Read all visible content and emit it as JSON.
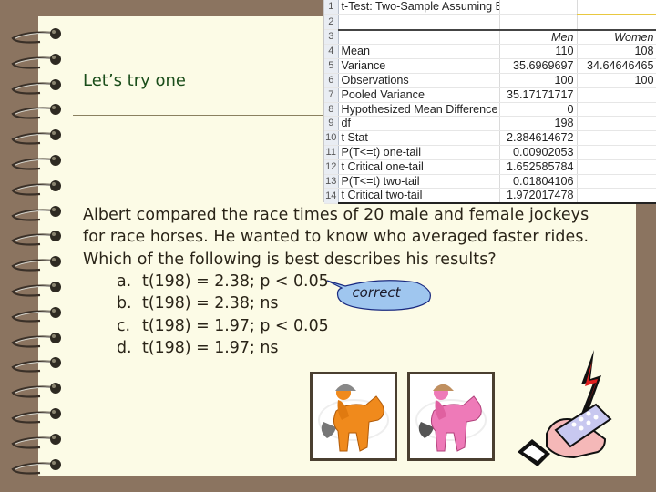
{
  "slide": {
    "title": "Let’s try one",
    "question_lines": [
      "Albert compared the race times of 20 male and female jockeys",
      "for race horses.  He wanted to know who averaged faster rides.",
      "Which of the following is best describes  his results?"
    ],
    "options": [
      {
        "letter": "a.",
        "text": "t(198) = 2.38; p < 0.05"
      },
      {
        "letter": "b.",
        "text": "t(198) = 2.38; ns"
      },
      {
        "letter": "c.",
        "text": "t(198) = 1.97; p < 0.05"
      },
      {
        "letter": "d.",
        "text": "t(198) = 1.97; ns"
      }
    ],
    "callout": "correct",
    "colors": {
      "background": "#8b7460",
      "page": "#fcfbe6",
      "title": "#1a4d1a",
      "callout_fill": "#9fc6ef",
      "male_jockey": "#f08a1c",
      "female_jockey": "#ee7ab8"
    },
    "images": {
      "male": "orange-jockey-on-horse",
      "female": "pink-jockey-on-horse",
      "remote": "hand-holding-remote-with-lightning"
    }
  },
  "spreadsheet": {
    "rows": [
      {
        "n": "1",
        "label": "t-Test: Two-Sample Assuming Equal Variances",
        "men": "",
        "women": ""
      },
      {
        "n": "2",
        "label": "",
        "men": "",
        "women": ""
      },
      {
        "n": "3",
        "label": "",
        "men": "Men",
        "women": "Women"
      },
      {
        "n": "4",
        "label": "Mean",
        "men": "110",
        "women": "108"
      },
      {
        "n": "5",
        "label": "Variance",
        "men": "35.6969697",
        "women": "34.64646465"
      },
      {
        "n": "6",
        "label": "Observations",
        "men": "100",
        "women": "100"
      },
      {
        "n": "7",
        "label": "Pooled Variance",
        "men": "35.17171717",
        "women": ""
      },
      {
        "n": "8",
        "label": "Hypothesized Mean Difference",
        "men": "0",
        "women": ""
      },
      {
        "n": "9",
        "label": "df",
        "men": "198",
        "women": ""
      },
      {
        "n": "10",
        "label": "t Stat",
        "men": "2.384614672",
        "women": ""
      },
      {
        "n": "11",
        "label": "P(T<=t) one-tail",
        "men": "0.00902053",
        "women": ""
      },
      {
        "n": "12",
        "label": "t Critical one-tail",
        "men": "1.652585784",
        "women": ""
      },
      {
        "n": "13",
        "label": "P(T<=t) two-tail",
        "men": "0.01804106",
        "women": ""
      },
      {
        "n": "14",
        "label": "t Critical two-tail",
        "men": "1.972017478",
        "women": ""
      }
    ]
  }
}
